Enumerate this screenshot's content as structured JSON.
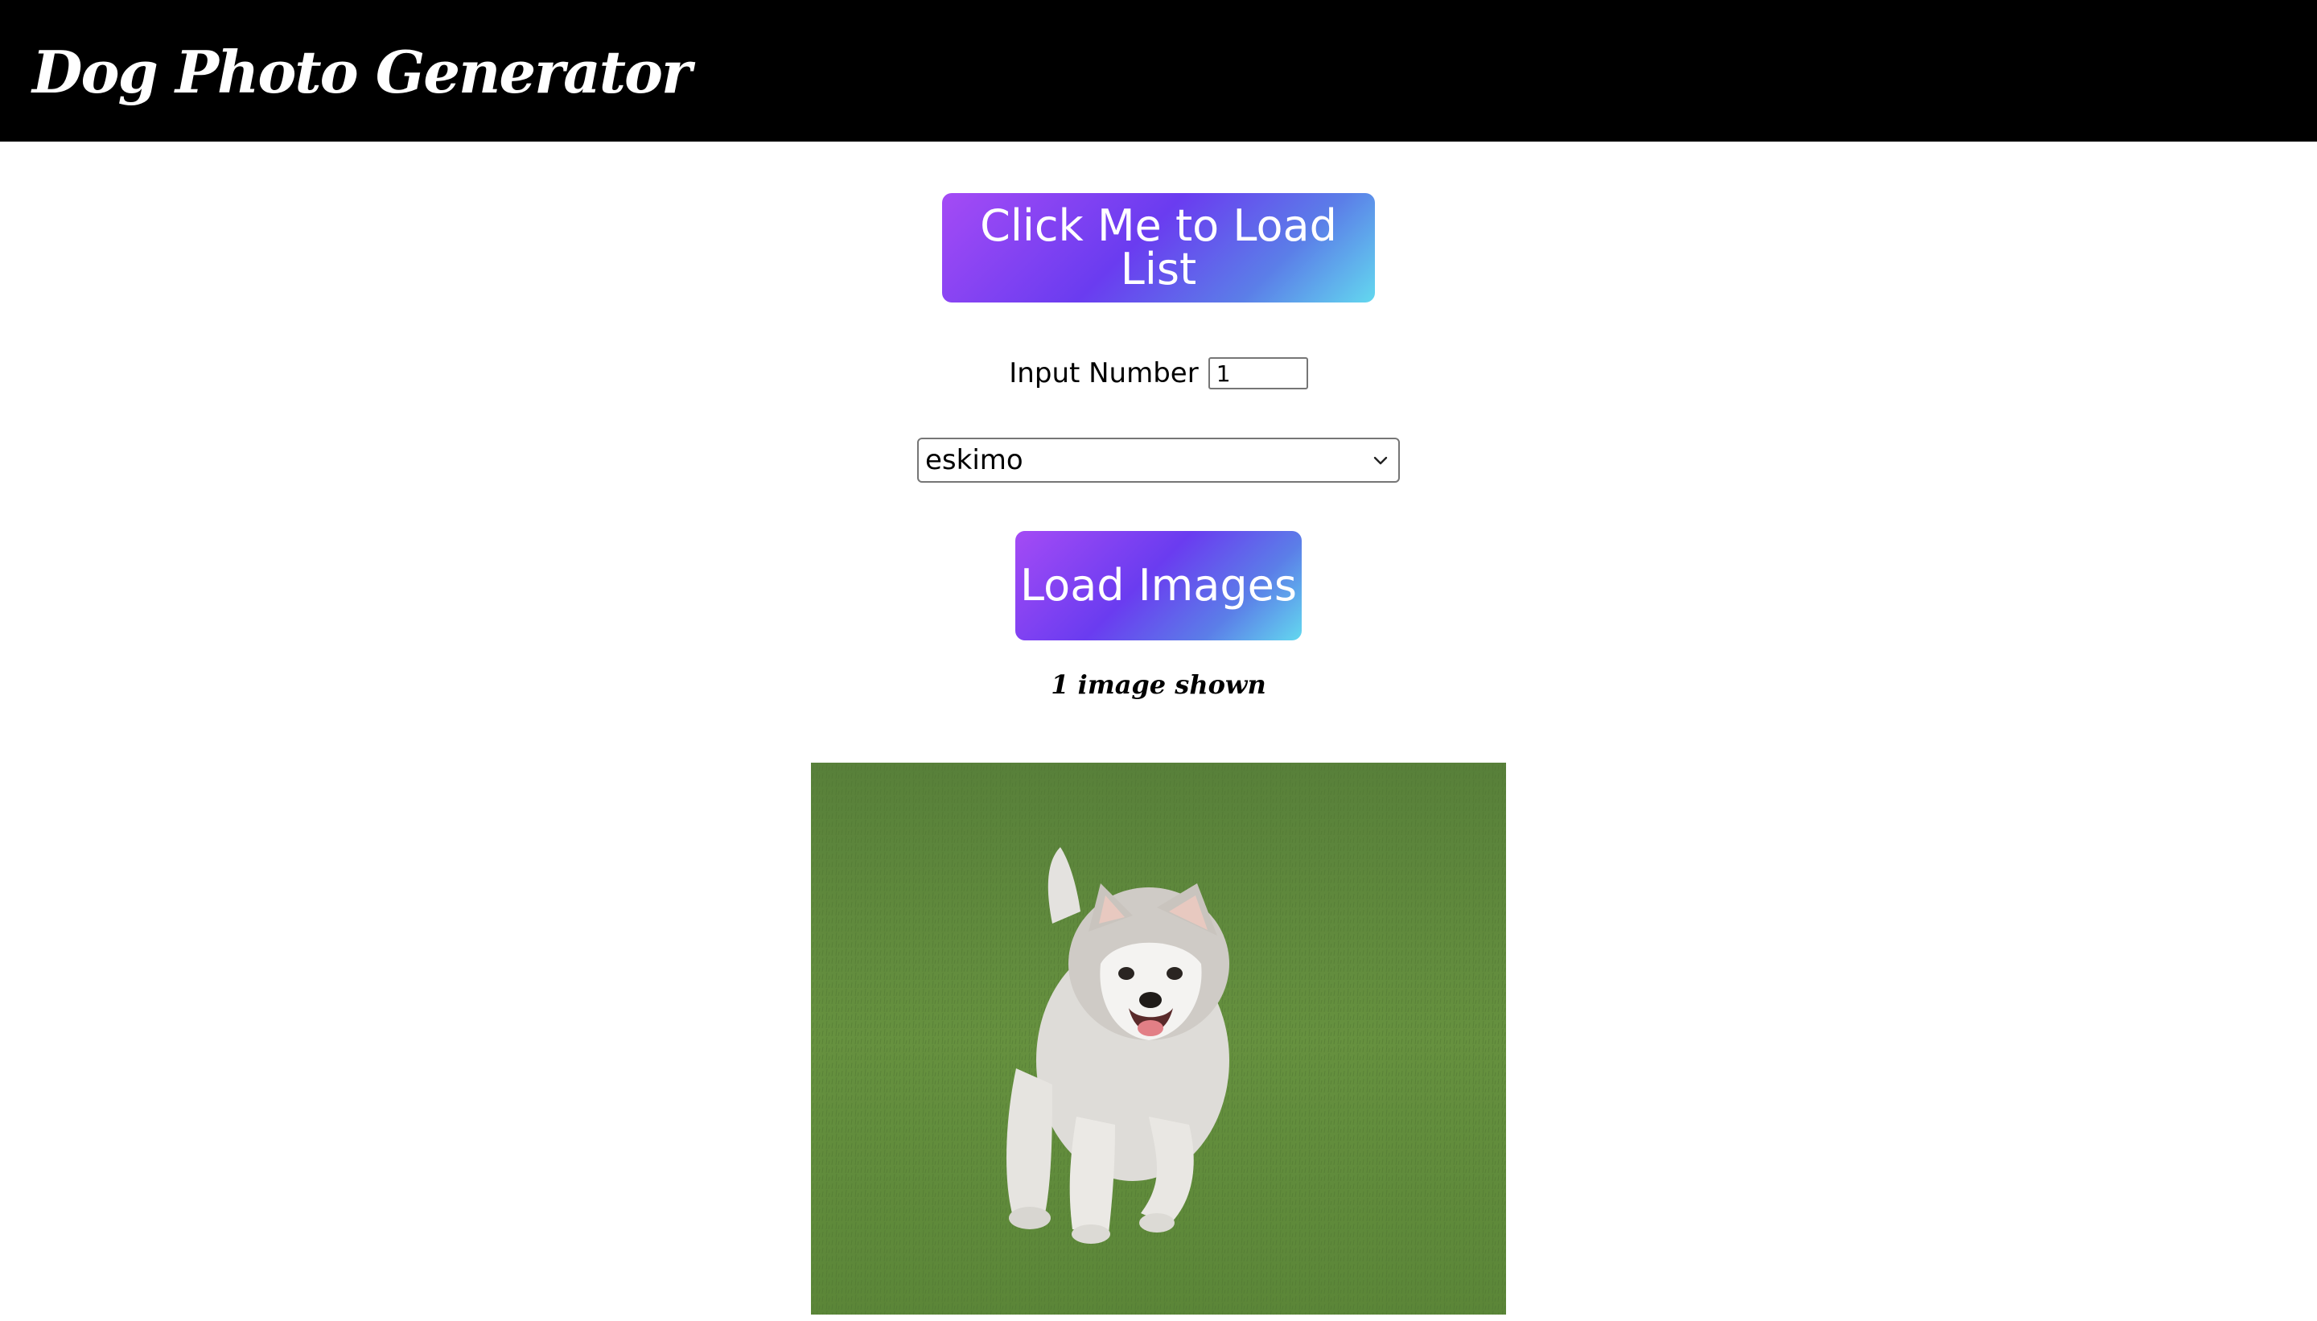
{
  "header": {
    "title": "Dog Photo Generator"
  },
  "controls": {
    "load_list_label": "Click Me to Load List",
    "number_label": "Input Number",
    "number_value": "1",
    "breed_selected": "eskimo",
    "load_images_label": "Load Images"
  },
  "results": {
    "count_text": "1 image shown"
  },
  "icons": {
    "select_chevron": "chevron-down-icon"
  },
  "colors": {
    "header_bg": "#000000",
    "button_gradient_start": "#a44bf5",
    "button_gradient_mid": "#6a3cf0",
    "button_gradient_end": "#63d8ef",
    "grass": "#5f8a3c"
  }
}
